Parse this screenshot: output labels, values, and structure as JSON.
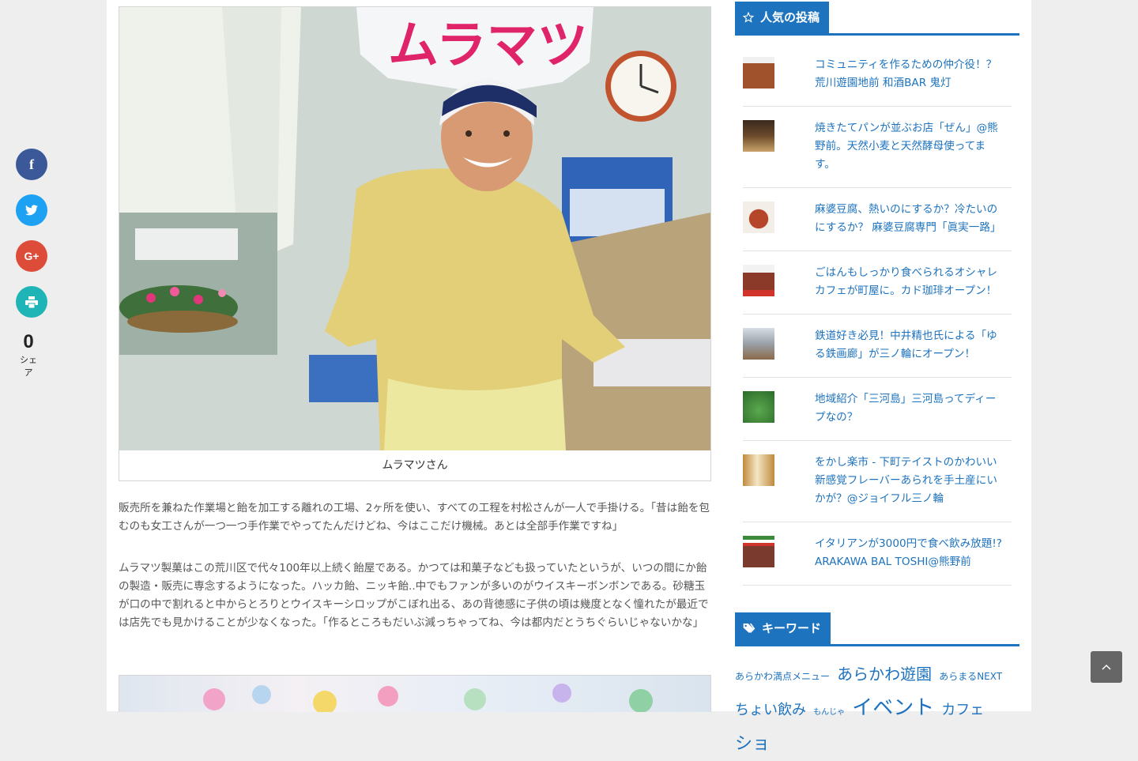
{
  "share": {
    "buttons": [
      {
        "icon": "facebook-icon",
        "glyph": "f",
        "color": "#3b5998"
      },
      {
        "icon": "twitter-icon",
        "glyph": "",
        "color": "#1da1f2"
      },
      {
        "icon": "google-plus-icon",
        "glyph": "G+",
        "color": "#dd4b39"
      },
      {
        "icon": "print-icon",
        "glyph": "",
        "color": "#1fb5b7"
      }
    ],
    "count": "0",
    "count_label": "シェア"
  },
  "article": {
    "sign_text": "ムラマツ",
    "figure_caption": "ムラマツさん",
    "paragraph1": "販売所を兼ねた作業場と飴を加工する離れの工場、2ヶ所を使い、すべての工程を村松さんが一人で手掛ける。「昔は飴を包むのも女工さんが一つ一つ手作業でやってたんだけどね、今はここだけ機械。あとは全部手作業ですね」",
    "paragraph2": "ムラマツ製菓はこの荒川区で代々100年以上続く飴屋である。かつては和菓子なども扱っていたというが、いつの間にか飴の製造・販売に専念するようになった。ハッカ飴、ニッキ飴..中でもファンが多いのがウイスキーボンボンである。砂糖玉が口の中で割れると中からとろりとウイスキーシロップがこぼれ出る、あの背徳感に子供の頃は幾度となく憧れたが最近では店先でも見かけることが少なくなった。「作るところもだいぶ減っちゃってね、今は都内だとうちぐらいじゃないかな」"
  },
  "sidebar": {
    "popular_title": "人気の投稿",
    "popular_icon": "star-icon",
    "posts": [
      {
        "title": "コミュニティを作るための仲介役！？荒川遊園地前 和酒BAR 鬼灯",
        "thumb_color": "#a0522d"
      },
      {
        "title": "焼きたてパンが並ぶお店「ぜん」@熊野前。天然小麦と天然酵母使ってます。",
        "thumb_color": "#6b4a2b"
      },
      {
        "title": "麻婆豆腐、熱いのにするか？冷たいのにするか？ 麻婆豆腐専門「眞実一路」",
        "thumb_color": "#b5462a"
      },
      {
        "title": "ごはんもしっかり食べられるオシャレカフェが町屋に。カド珈琲オープン！",
        "thumb_color": "#8b3a2a"
      },
      {
        "title": "鉄道好き必見！中井精也氏による「ゆる鉄画廊」が三ノ輪にオープン！",
        "thumb_color": "#9aa0a8"
      },
      {
        "title": "地域紹介「三河島」三河島ってディープなの？",
        "thumb_color": "#3d8a3a"
      },
      {
        "title": "をかし楽市 - 下町テイストのかわいい新感覚フレーバーあられを手土産にいかが？@ジョイフル三ノ輪",
        "thumb_color": "#c08a3e"
      },
      {
        "title": "イタリアンが3000円で食べ飲み放題!? ARAKAWA BAL TOSHI@熊野前",
        "thumb_color": "#7a3b2e"
      }
    ],
    "keyword_title": "キーワード",
    "keyword_icon": "tags-icon",
    "keywords": [
      {
        "text": "あらかわ満点メニュー",
        "size": 12
      },
      {
        "text": "あらかわ遊園",
        "size": 20
      },
      {
        "text": "あらまるNEXT",
        "size": 12
      },
      {
        "text": "ちょい飲み",
        "size": 18
      },
      {
        "text": "もんじゃ",
        "size": 10
      },
      {
        "text": "イベント",
        "size": 26
      },
      {
        "text": "カフェ",
        "size": 18
      },
      {
        "text": "ショ",
        "size": 22
      }
    ]
  },
  "ui": {
    "accent": "#1e73be",
    "back_to_top_icon": "chevron-up-icon"
  }
}
